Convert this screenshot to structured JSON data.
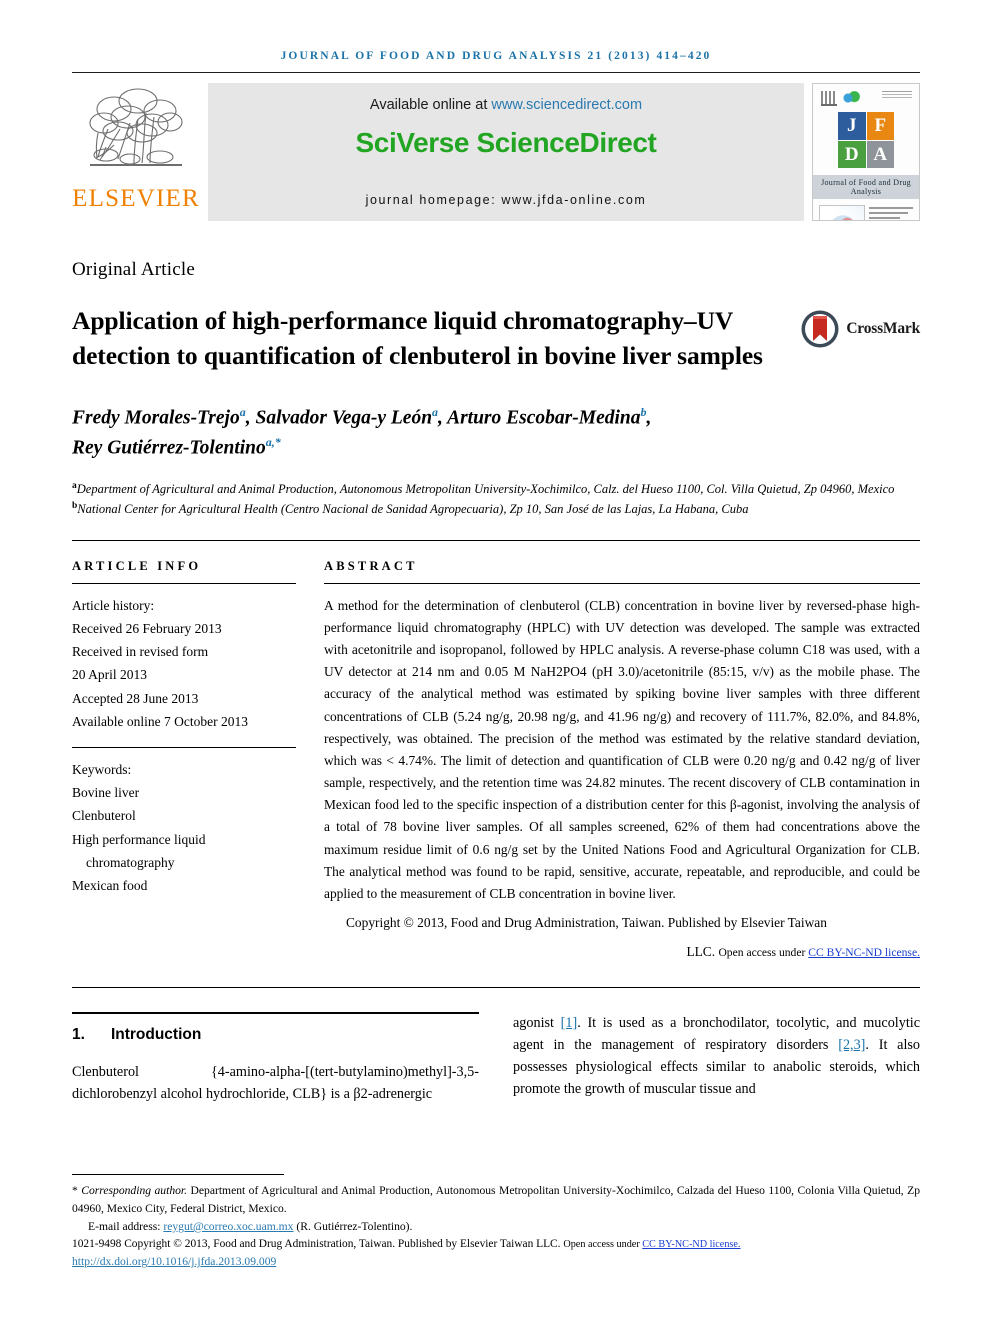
{
  "running_head": "Journal of Food and Drug Analysis 21 (2013) 414–420",
  "masthead": {
    "publisher_name": "ELSEVIER",
    "available_prefix": "Available online at ",
    "available_url": "www.sciencedirect.com",
    "platform": "SciVerse ScienceDirect",
    "homepage": "journal homepage: www.jfda-online.com",
    "cover_title": "Journal of Food and Drug Analysis",
    "cover_letters": [
      "J",
      "F",
      "D",
      "A"
    ]
  },
  "article": {
    "type": "Original Article",
    "title": "Application of high-performance liquid chromatography–UV detection to quantification of clenbuterol in bovine liver samples",
    "crossmark_label": "CrossMark",
    "authors": "Fredy Morales-Trejoᵃ, Salvador Vega-y Leónᵃ, Arturo Escobar-Medinaᵇ, Rey Gutiérrez-Tolentinoᵃ,*",
    "authors_parts": [
      {
        "name": "Fredy Morales-Trejo",
        "sup": "a",
        "sep": ", "
      },
      {
        "name": "Salvador Vega-y León",
        "sup": "a",
        "sep": ", "
      },
      {
        "name": "Arturo Escobar-Medina",
        "sup": "b",
        "sep": ","
      },
      {
        "name": "Rey Gutiérrez-Tolentino",
        "sup": "a,*",
        "sep": ""
      }
    ],
    "affiliations": [
      {
        "marker": "a",
        "text": "Department of Agricultural and Animal Production, Autonomous Metropolitan University-Xochimilco, Calz. del Hueso 1100, Col. Villa Quietud, Zp 04960, Mexico"
      },
      {
        "marker": "b",
        "text": "National Center for Agricultural Health (Centro Nacional de Sanidad Agropecuaria), Zp 10, San José de las Lajas, La Habana, Cuba"
      }
    ]
  },
  "article_info": {
    "heading": "ARTICLE INFO",
    "history_label": "Article history:",
    "history": [
      "Received 26 February 2013",
      "Received in revised form",
      "20 April 2013",
      "Accepted 28 June 2013",
      "Available online 7 October 2013"
    ],
    "keywords_label": "Keywords:",
    "keywords": [
      "Bovine liver",
      "Clenbuterol",
      "High performance liquid chromatography",
      "Mexican food"
    ]
  },
  "abstract": {
    "heading": "ABSTRACT",
    "text": "A method for the determination of clenbuterol (CLB) concentration in bovine liver by reversed-phase high-performance liquid chromatography (HPLC) with UV detection was developed. The sample was extracted with acetonitrile and isopropanol, followed by HPLC analysis. A reverse-phase column C18 was used, with a UV detector at 214 nm and 0.05 M NaH2PO4 (pH 3.0)/acetonitrile (85:15, v/v) as the mobile phase. The accuracy of the analytical method was estimated by spiking bovine liver samples with three different concentrations of CLB (5.24 ng/g, 20.98 ng/g, and 41.96 ng/g) and recovery of 111.7%, 82.0%, and 84.8%, respectively, was obtained. The precision of the method was estimated by the relative standard deviation, which was < 4.74%. The limit of detection and quantification of CLB were 0.20 ng/g and 0.42 ng/g of liver sample, respectively, and the retention time was 24.82 minutes. The recent discovery of CLB contamination in Mexican food led to the specific inspection of a distribution center for this β-agonist, involving the analysis of a total of 78 bovine liver samples. Of all samples screened, 62% of them had concentrations above the maximum residue limit of 0.6 ng/g set by the United Nations Food and Agricultural Organization for CLB. The analytical method was found to be rapid, sensitive, accurate, repeatable, and reproducible, and could be applied to the measurement of CLB concentration in bovine liver.",
    "copyright_line": "Copyright © 2013, Food and Drug Administration, Taiwan. Published by Elsevier Taiwan",
    "copyright_line2_prefix": "LLC. ",
    "copyright_line2_small": "Open access under ",
    "copyright_link": "CC BY-NC-ND license."
  },
  "introduction": {
    "number": "1.",
    "heading": "Introduction",
    "left_paragraph": "Clenbuterol   {4-amino-alpha-[(tert-butylamino)methyl]-3,5-dichlorobenzyl alcohol hydrochloride, CLB} is a β2-adrenergic",
    "right_paragraph_p1": "agonist ",
    "right_ref1": "[1]",
    "right_paragraph_p2": ". It is used as a bronchodilator, tocolytic, and mucolytic agent in the management of respiratory disorders ",
    "right_ref2": "[2,3]",
    "right_paragraph_p3": ". It also possesses physiological effects similar to anabolic steroids, which promote the growth of muscular tissue and"
  },
  "footnotes": {
    "corresponding_marker": "*",
    "corresponding_italic": "Corresponding author.",
    "corresponding_text": " Department of Agricultural and Animal Production, Autonomous Metropolitan University-Xochimilco, Calzada del Hueso 1100, Colonia Villa Quietud, Zp 04960, Mexico City, Federal District, Mexico.",
    "email_label": "E-mail address: ",
    "email": "reygut@correo.xoc.uam.mx",
    "email_suffix": " (R. Gutiérrez-Tolentino).",
    "issn": "1021-9498",
    "issn_copyright": " Copyright © 2013, Food and Drug Administration, Taiwan. Published by Elsevier Taiwan LLC. ",
    "issn_open": "Open access under ",
    "issn_cc": "CC BY-NC-ND license.",
    "doi": "http://dx.doi.org/10.1016/j.jfda.2013.09.009"
  },
  "colors": {
    "journal_blue": "#1a72a8",
    "elsevier_orange": "#f08000",
    "sciencedirect_green": "#22a522",
    "cc_blue": "#1a3fd0",
    "banner_gray": "#e6e6e6"
  }
}
